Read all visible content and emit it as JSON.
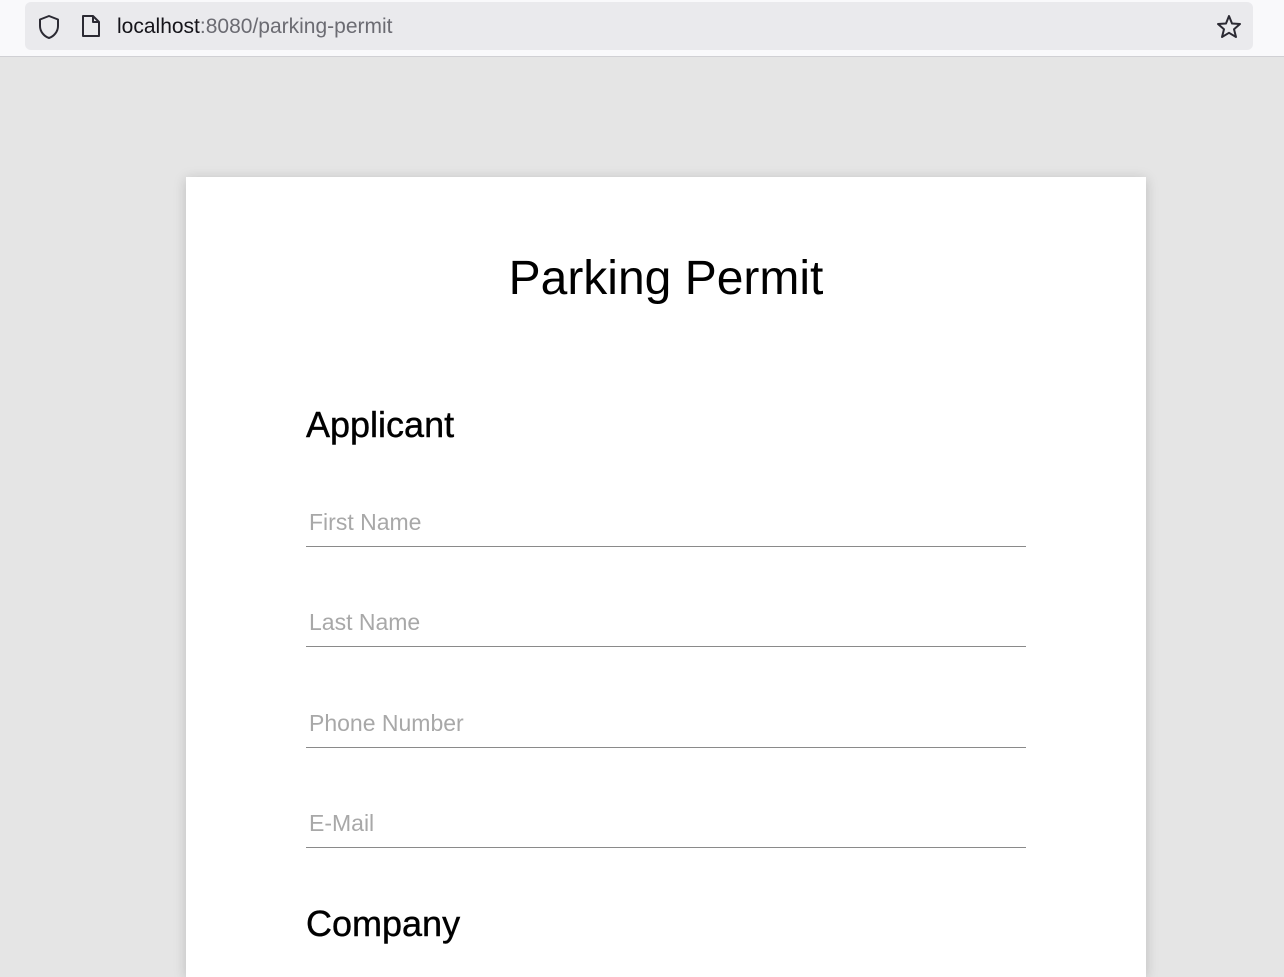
{
  "browser": {
    "url_host": "localhost",
    "url_path": ":8080/parking-permit",
    "icons": [
      "shield-icon",
      "page-icon",
      "star-icon"
    ]
  },
  "form": {
    "title": "Parking Permit",
    "sections": {
      "applicant": {
        "heading": "Applicant",
        "fields": {
          "first_name": {
            "placeholder": "First Name",
            "value": ""
          },
          "last_name": {
            "placeholder": "Last Name",
            "value": ""
          },
          "phone_number": {
            "placeholder": "Phone Number",
            "value": ""
          },
          "email": {
            "placeholder": "E-Mail",
            "value": ""
          }
        }
      },
      "company": {
        "heading": "Company"
      }
    }
  }
}
